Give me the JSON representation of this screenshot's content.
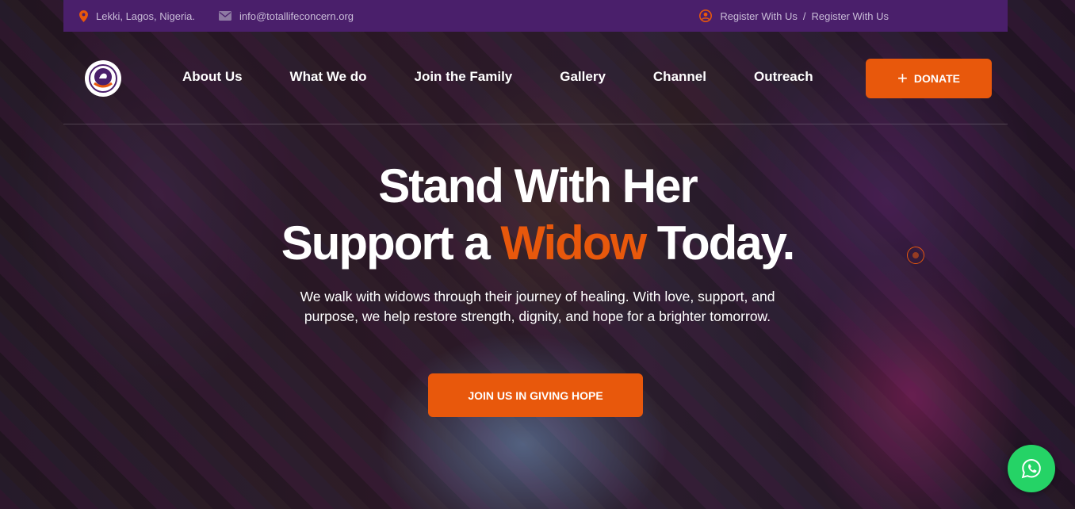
{
  "topbar": {
    "location": "Lekki, Lagos, Nigeria.",
    "email": "info@totallifeconcern.org",
    "register_1": "Register With Us",
    "separator": "/",
    "register_2": "Register With Us"
  },
  "nav": {
    "items": [
      "About Us",
      "What We do",
      "Join the Family",
      "Gallery",
      "Channel",
      "Outreach"
    ],
    "donate_label": "DONATE"
  },
  "hero": {
    "line1": "Stand With Her",
    "line2_pre": "Support a ",
    "line2_accent": "Widow",
    "line2_post": " Today.",
    "subtext_1": "We walk with widows through their journey of healing. With love, support, and",
    "subtext_2": "purpose, we help restore strength, dignity, and hope for a brighter tomorrow.",
    "cta_label": "JOIN US IN GIVING HOPE"
  },
  "colors": {
    "topbar_bg": "#4a1f6b",
    "accent": "#e8580c",
    "whatsapp": "#25d366"
  },
  "icons": {
    "location": "map-pin-icon",
    "email": "envelope-icon",
    "register": "user-circle-icon",
    "donate": "plus-icon",
    "whatsapp": "whatsapp-icon"
  }
}
